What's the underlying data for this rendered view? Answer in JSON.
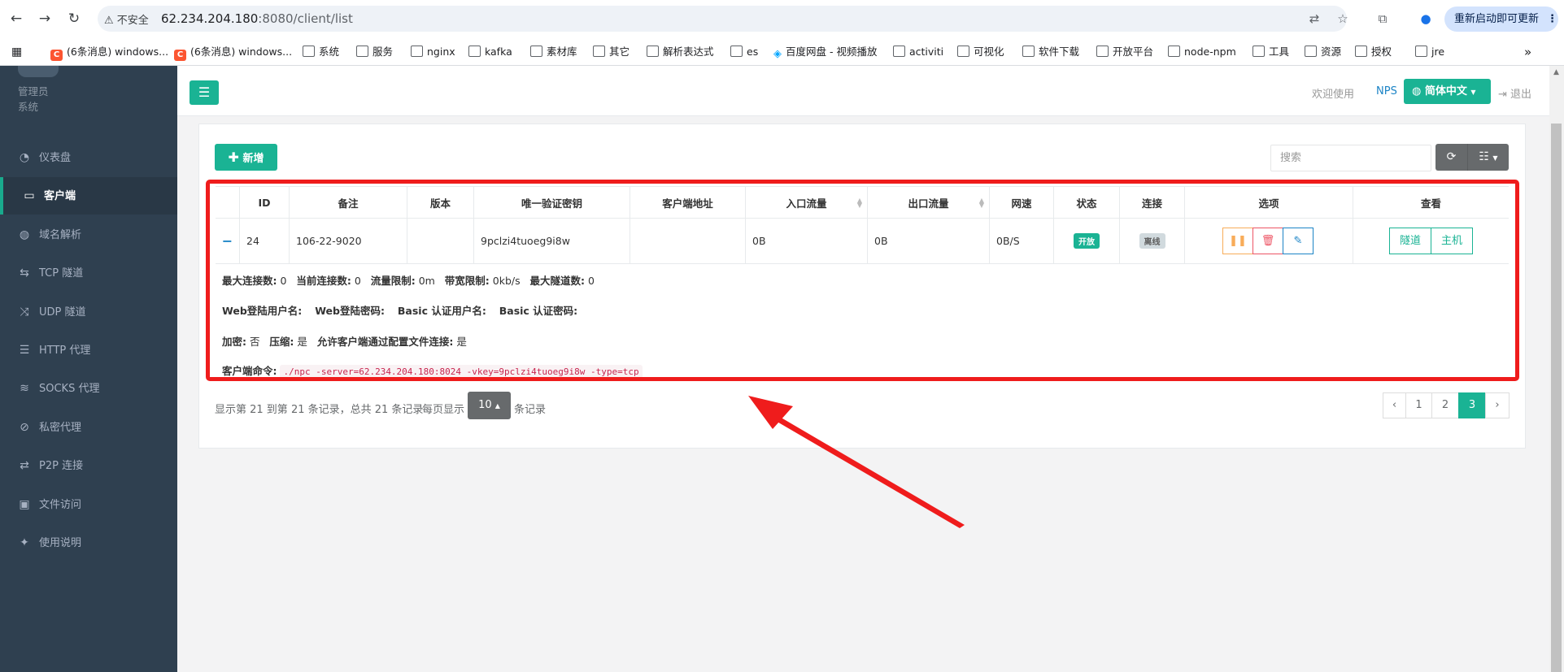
{
  "browser": {
    "insecure_label": "不安全",
    "url_host": "62.234.204.180",
    "url_rest": ":8080/client/list",
    "restart_label": "重新启动即可更新",
    "bookmarks": [
      {
        "label": "(6条消息) windows...",
        "icon": "csdn-icon"
      },
      {
        "label": "(6条消息) windows...",
        "icon": "csdn-icon"
      },
      {
        "label": "系统",
        "icon": "folder-icon"
      },
      {
        "label": "服务",
        "icon": "folder-icon"
      },
      {
        "label": "nginx",
        "icon": "folder-icon"
      },
      {
        "label": "kafka",
        "icon": "folder-icon"
      },
      {
        "label": "素材库",
        "icon": "folder-icon"
      },
      {
        "label": "其它",
        "icon": "folder-icon"
      },
      {
        "label": "解析表达式",
        "icon": "folder-icon"
      },
      {
        "label": "es",
        "icon": "folder-icon"
      },
      {
        "label": "百度网盘 - 视频播放",
        "icon": "baidu-pan-icon"
      },
      {
        "label": "activiti",
        "icon": "folder-icon"
      },
      {
        "label": "可视化",
        "icon": "folder-icon"
      },
      {
        "label": "软件下载",
        "icon": "folder-icon"
      },
      {
        "label": "开放平台",
        "icon": "folder-icon"
      },
      {
        "label": "node-npm",
        "icon": "folder-icon"
      },
      {
        "label": "工具",
        "icon": "folder-icon"
      },
      {
        "label": "资源",
        "icon": "folder-icon"
      },
      {
        "label": "授权",
        "icon": "folder-icon"
      },
      {
        "label": "jre",
        "icon": "folder-icon"
      }
    ]
  },
  "sidebar": {
    "user_role": "管理员",
    "user_sub": "系统",
    "items": [
      {
        "label": "仪表盘",
        "icon": "dashboard-icon"
      },
      {
        "label": "客户端",
        "icon": "desktop-icon",
        "active": true
      },
      {
        "label": "域名解析",
        "icon": "globe-icon"
      },
      {
        "label": "TCP 隧道",
        "icon": "retweet-icon"
      },
      {
        "label": "UDP 隧道",
        "icon": "random-icon"
      },
      {
        "label": "HTTP 代理",
        "icon": "list-icon"
      },
      {
        "label": "SOCKS 代理",
        "icon": "layers-icon"
      },
      {
        "label": "私密代理",
        "icon": "eye-slash-icon"
      },
      {
        "label": "P2P 连接",
        "icon": "exchange-icon"
      },
      {
        "label": "文件访问",
        "icon": "briefcase-icon"
      },
      {
        "label": "使用说明",
        "icon": "lightbulb-icon"
      }
    ]
  },
  "topbar": {
    "welcome": "欢迎使用",
    "brand": "NPS",
    "language": "简体中文",
    "logout": "退出"
  },
  "toolbar": {
    "add_label": "新增",
    "search_placeholder": "搜索"
  },
  "table": {
    "headers": [
      "ID",
      "备注",
      "版本",
      "唯一验证密钥",
      "客户端地址",
      "入口流量",
      "出口流量",
      "网速",
      "状态",
      "连接",
      "选项",
      "查看"
    ],
    "row": {
      "id": "24",
      "remark": "106-22-9020",
      "version": "",
      "vkey": "9pclzi4tuoeg9i8w",
      "address": "",
      "in_flow": "0B",
      "out_flow": "0B",
      "speed": "0B/S",
      "status": "开放",
      "connection": "离线",
      "view_tunnel": "隧道",
      "view_host": "主机"
    },
    "detail": {
      "max_conn_label": "最大连接数:",
      "max_conn": "0",
      "cur_conn_label": "当前连接数:",
      "cur_conn": "0",
      "flow_limit_label": "流量限制:",
      "flow_limit": "0m",
      "rate_limit_label": "带宽限制:",
      "rate_limit": "0kb/s",
      "max_tunnel_label": "最大隧道数:",
      "max_tunnel": "0",
      "web_user_label": "Web登陆用户名:",
      "web_pass_label": "Web登陆密码:",
      "basic_user_label": "Basic 认证用户名:",
      "basic_pass_label": "Basic 认证密码:",
      "crypt_label": "加密:",
      "crypt": "否",
      "compress_label": "压缩:",
      "compress": "是",
      "config_conn_label": "允许客户端通过配置文件连接:",
      "config_conn": "是",
      "cmd_label": "客户端命令:",
      "cmd": "./npc -server=62.234.204.180:8024 -vkey=9pclzi4tuoeg9i8w -type=tcp"
    }
  },
  "pagination": {
    "info": "显示第 21 到第 21 条记录，总共 21 条记录",
    "per_page_prefix": "每页显示",
    "page_size": "10",
    "per_page_suffix": "条记录",
    "prev": "‹",
    "next": "›",
    "pages": [
      "1",
      "2",
      "3"
    ],
    "current": "3"
  },
  "colors": {
    "accent": "#1ab394",
    "sidebar": "#2f4050",
    "annotation": "#ef1c1c"
  }
}
